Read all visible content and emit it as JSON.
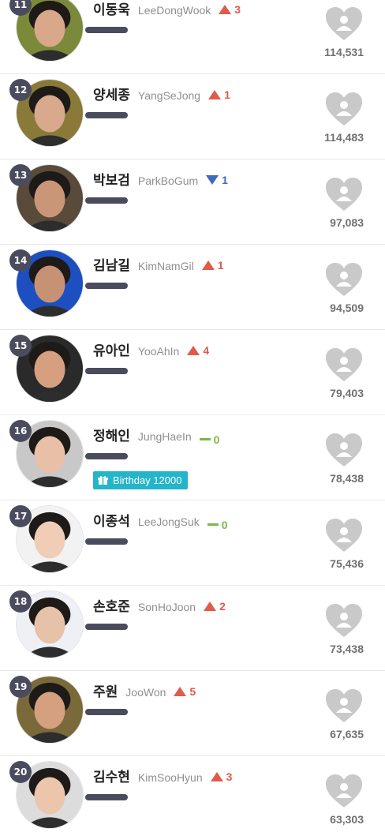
{
  "ranking": [
    {
      "rank": "11",
      "kname": "이동욱",
      "ename": "LeeDongWook",
      "change_dir": "up",
      "change": "3",
      "votes": "114,531",
      "avatar_color": "#7a8a3a",
      "skin": "#d9a88a"
    },
    {
      "rank": "12",
      "kname": "양세종",
      "ename": "YangSeJong",
      "change_dir": "up",
      "change": "1",
      "votes": "114,483",
      "avatar_color": "#8a7a3a",
      "skin": "#d8a98c"
    },
    {
      "rank": "13",
      "kname": "박보검",
      "ename": "ParkBoGum",
      "change_dir": "down",
      "change": "1",
      "votes": "97,083",
      "avatar_color": "#5a4a3a",
      "skin": "#c99677"
    },
    {
      "rank": "14",
      "kname": "김남길",
      "ename": "KimNamGil",
      "change_dir": "up",
      "change": "1",
      "votes": "94,509",
      "avatar_color": "#1d4fc0",
      "skin": "#c79273"
    },
    {
      "rank": "15",
      "kname": "유아인",
      "ename": "YooAhIn",
      "change_dir": "up",
      "change": "4",
      "votes": "79,403",
      "avatar_color": "#2a2a2a",
      "skin": "#d6a080"
    },
    {
      "rank": "16",
      "kname": "정해인",
      "ename": "JungHaeIn",
      "change_dir": "same",
      "change": "0",
      "votes": "78,438",
      "avatar_color": "#c8c8c8",
      "skin": "#e8c0a8",
      "badge": "Birthday 12000"
    },
    {
      "rank": "17",
      "kname": "이종석",
      "ename": "LeeJongSuk",
      "change_dir": "same",
      "change": "0",
      "votes": "75,436",
      "avatar_color": "#f2f2f2",
      "skin": "#efcdb6"
    },
    {
      "rank": "18",
      "kname": "손호준",
      "ename": "SonHoJoon",
      "change_dir": "up",
      "change": "2",
      "votes": "73,438",
      "avatar_color": "#eef0f6",
      "skin": "#e6c2a8"
    },
    {
      "rank": "19",
      "kname": "주원",
      "ename": "JooWon",
      "change_dir": "up",
      "change": "5",
      "votes": "67,635",
      "avatar_color": "#7a6a3a",
      "skin": "#d4a080"
    },
    {
      "rank": "20",
      "kname": "김수현",
      "ename": "KimSooHyun",
      "change_dir": "up",
      "change": "3",
      "votes": "63,303",
      "avatar_color": "#dcdcdc",
      "skin": "#ebc5ac"
    }
  ],
  "colors": {
    "rank_badge": "#4a4c5e",
    "up": "#e05b4a",
    "down": "#3c6bbf",
    "same": "#79b84a",
    "heart": "#c9c9c9",
    "birthday_badge": "#23b5c9"
  },
  "icons": {
    "vote": "heart-user-icon",
    "birthday": "gift-icon"
  }
}
